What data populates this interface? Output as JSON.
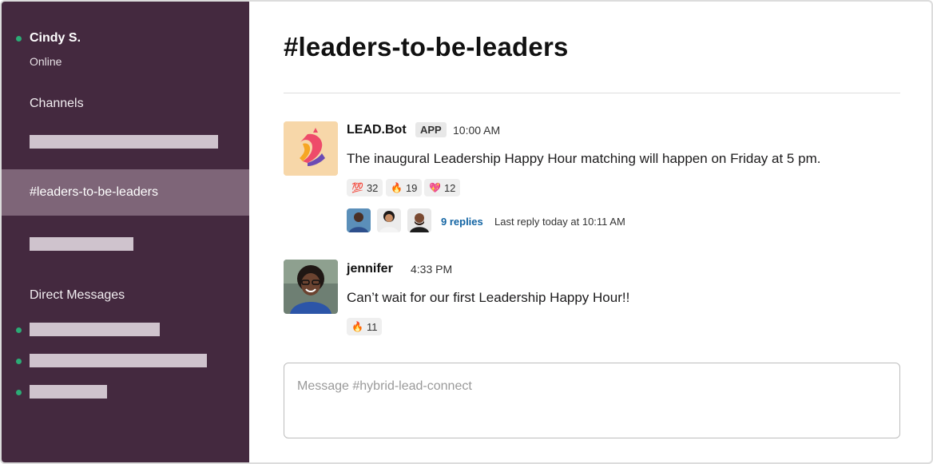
{
  "sidebar": {
    "user": {
      "name": "Cindy S.",
      "status": "Online"
    },
    "channels_label": "Channels",
    "active_channel": "#leaders-to-be-leaders",
    "dm_label": "Direct Messages"
  },
  "channel": {
    "title": "#leaders-to-be-leaders"
  },
  "messages": [
    {
      "author": "LEAD.Bot",
      "badge": "APP",
      "time": "10:00 AM",
      "text": "The inaugural Leadership Happy Hour matching will happen on Friday at 5 pm.",
      "reactions": [
        {
          "icon": "hundred-points-icon",
          "glyph": "💯",
          "count": "32"
        },
        {
          "icon": "fire-icon",
          "glyph": "🔥",
          "count": "19"
        },
        {
          "icon": "heart-icon",
          "glyph": "💖",
          "count": "12"
        }
      ],
      "thread": {
        "replies": "9 replies",
        "last_reply": "Last reply today at 10:11 AM"
      }
    },
    {
      "author": "jennifer",
      "time": "4:33 PM",
      "text": "Can’t wait for our first Leadership Happy Hour!!",
      "reactions": [
        {
          "icon": "fire-icon",
          "glyph": "🔥",
          "count": "11"
        }
      ]
    }
  ],
  "composer": {
    "placeholder": "Message #hybrid-lead-connect"
  },
  "colors": {
    "sidebar_bg": "#44293f",
    "active_channel_bg": "#7e6578",
    "presence": "#2bac76",
    "link": "#1264a3"
  }
}
